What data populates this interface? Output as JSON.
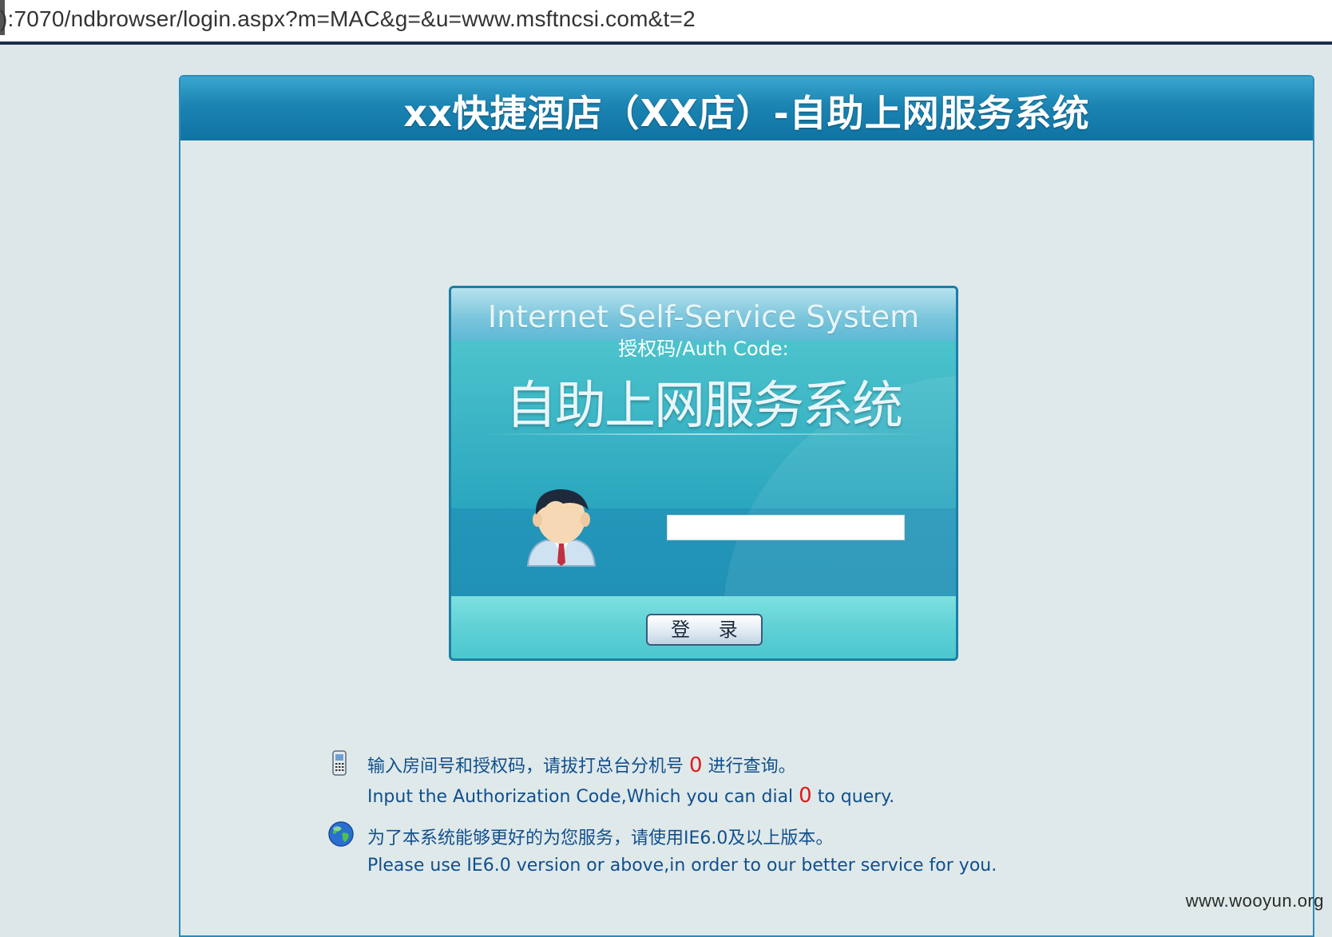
{
  "browser": {
    "url": "):7070/ndbrowser/login.aspx?m=MAC&g=&u=www.msftncsi.com&t=2"
  },
  "page": {
    "title": "xx快捷酒店（XX店）-自助上网服务系统"
  },
  "login": {
    "heading_en": "Internet Self-Service System",
    "auth_label": "授权码/Auth Code:",
    "heading_cn": "自助上网服务系统",
    "auth_input_value": "",
    "login_button": "登 录"
  },
  "info": {
    "line1_prefix": "输入房间号和授权码，请拔打总台分机号",
    "line1_number": "0",
    "line1_suffix": "进行查询。",
    "line2_prefix": "Input the Authorization Code,Which you can dial",
    "line2_number": "0",
    "line2_suffix": "to query.",
    "line3": "为了本系统能够更好的为您服务，请使用IE6.0及以上版本。",
    "line4": "Please use IE6.0 version or above,in order to our better service for you."
  },
  "watermark": "www.wooyun.org",
  "icons": {
    "phone": "mobile-phone-icon",
    "globe": "globe-icon",
    "avatar": "user-avatar-icon"
  },
  "colors": {
    "header_blue": "#1b84b2",
    "accent_red": "#e11a1a",
    "info_text": "#114f8c"
  }
}
